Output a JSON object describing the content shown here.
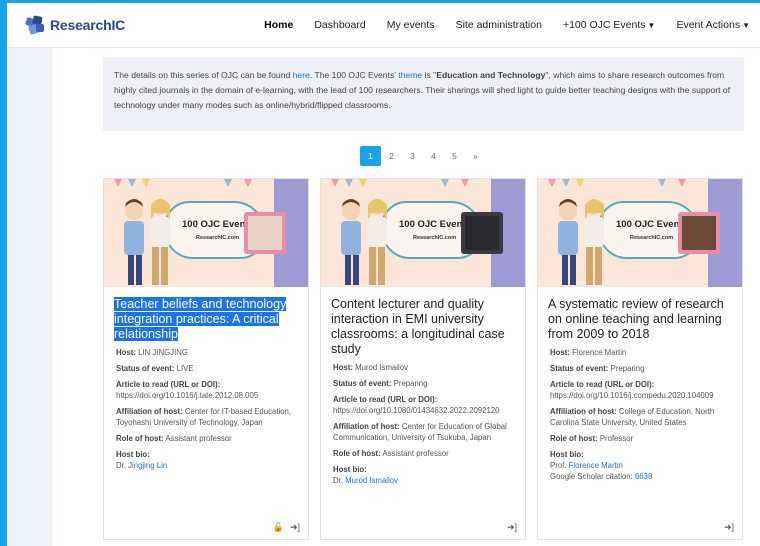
{
  "brand": {
    "name": "ResearchIC"
  },
  "nav": {
    "home": "Home",
    "dashboard": "Dashboard",
    "my_events": "My events",
    "site_admin": "Site administration",
    "ojc_events": "+100 OJC Events",
    "event_actions": "Event Actions"
  },
  "info": {
    "p1": "The details on this series of OJC can be found ",
    "link_here": "here",
    "p2": ". The 100 OJC Events' ",
    "link_theme": "theme",
    "p3": " is \"",
    "theme_bold": "Education and Technology",
    "p4": "\", which aims to share research outcomes from highly cited journals in the domain of e-learning, with the lead of 100 researchers. Their sharings will shed light to guide better teaching designs with the support of technology under many modes such as online/hybrid/flipped classrooms."
  },
  "pager": {
    "pages": [
      "1",
      "2",
      "3",
      "4",
      "5",
      "»"
    ],
    "active": "1"
  },
  "banner": {
    "title": "100 OJC Events",
    "subtitle": "ResearchIC.com"
  },
  "labels": {
    "host": "Host:",
    "status": "Status of event:",
    "article": "Article to read (URL or DOI):",
    "affiliation": "Affiliation of host:",
    "role": "Role of host:",
    "bio": "Host bio:"
  },
  "cards": [
    {
      "title": "Teacher beliefs and technology integration practices: A critical relationship",
      "host": "LIN JINGJING",
      "status": "LIVE",
      "article": "https://doi.org/10.1016/j.tate.2012.08.005",
      "affiliation": "Center for IT-based Education, Toyohashi University of Technology, Japan",
      "role": "Assistant professor",
      "bio_prefix": "Dr. ",
      "bio_link": "Jingjing Lin"
    },
    {
      "title": "Content lecturer and quality interaction in EMI university classrooms: a longitudinal case study",
      "host": "Murod Ismailov",
      "status": "Preparing",
      "article": "https://doi.org/10.1080/01434632.2022.2092120",
      "affiliation": "Center for Education of Global Communication, University of Tsukuba, Japan",
      "role": "Assistant professor",
      "bio_prefix": "Dr. ",
      "bio_link": "Murod Ismailov"
    },
    {
      "title": "A systematic review of research on online teaching and learning from 2009 to 2018",
      "host": "Florence Martin",
      "status": "Preparing",
      "article": "https://doi.org/10.1016/j.compedu.2020.104009",
      "affiliation": "College of Education, North Carolina State University, United States",
      "role": "Professor",
      "bio_prefix": "Prof. ",
      "bio_link": "Florence Martin",
      "citation_label": "Google Scholar citation: ",
      "citation_value": "6638"
    }
  ],
  "icons": {
    "lock": "lock-icon",
    "enter": "sign-in-icon"
  },
  "colors": {
    "accent": "#1aa3e8",
    "link": "#1a73c8",
    "brand": "#2b4a8c",
    "highlight": "#1a73e8"
  }
}
